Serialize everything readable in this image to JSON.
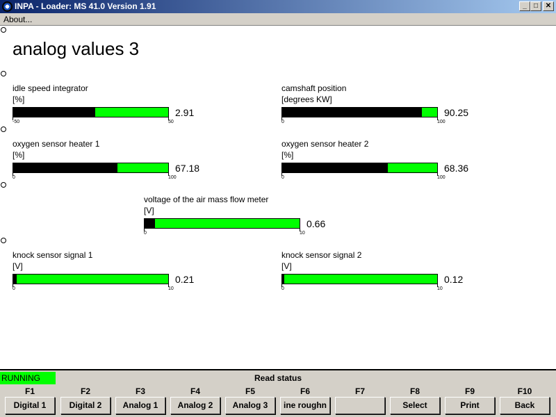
{
  "window": {
    "title": "INPA - Loader:  MS 41.0 Version 1.91",
    "min": "_",
    "max": "□",
    "close": "✕"
  },
  "menu": {
    "about": "About..."
  },
  "page_title": "analog values 3",
  "gauges": [
    {
      "label": "idle speed integrator",
      "unit": "[%]",
      "value": "2.91",
      "min": "-50",
      "max": "50",
      "fraction": 0.529
    },
    {
      "label": "camshaft position",
      "unit": "[degrees KW]",
      "value": "90.25",
      "min": "0",
      "max": "100",
      "fraction": 0.9025
    },
    {
      "label": "oxygen sensor heater 1",
      "unit": "[%]",
      "value": "67.18",
      "min": "0",
      "max": "100",
      "fraction": 0.6718
    },
    {
      "label": "oxygen sensor heater 2",
      "unit": "[%]",
      "value": "68.36",
      "min": "0",
      "max": "100",
      "fraction": 0.6836
    },
    {
      "label": "voltage of the air mass flow meter",
      "unit": "[V]",
      "value": "0.66",
      "min": "0",
      "max": "10",
      "fraction": 0.066
    },
    {
      "label": "knock sensor signal 1",
      "unit": "[V]",
      "value": "0.21",
      "min": "0",
      "max": "10",
      "fraction": 0.021
    },
    {
      "label": "knock sensor signal 2",
      "unit": "[V]",
      "value": "0.12",
      "min": "0",
      "max": "10",
      "fraction": 0.012
    }
  ],
  "status": {
    "state": "RUNNING",
    "title": "Read status",
    "state_color": "#00ff00"
  },
  "fkeys": [
    {
      "key": "F1",
      "label": "Digital 1"
    },
    {
      "key": "F2",
      "label": "Digital 2"
    },
    {
      "key": "F3",
      "label": "Analog 1"
    },
    {
      "key": "F4",
      "label": "Analog 2"
    },
    {
      "key": "F5",
      "label": "Analog 3"
    },
    {
      "key": "F6",
      "label": "ine roughn"
    },
    {
      "key": "F7",
      "label": ""
    },
    {
      "key": "F8",
      "label": "Select"
    },
    {
      "key": "F9",
      "label": "Print"
    },
    {
      "key": "F10",
      "label": "Back"
    }
  ]
}
